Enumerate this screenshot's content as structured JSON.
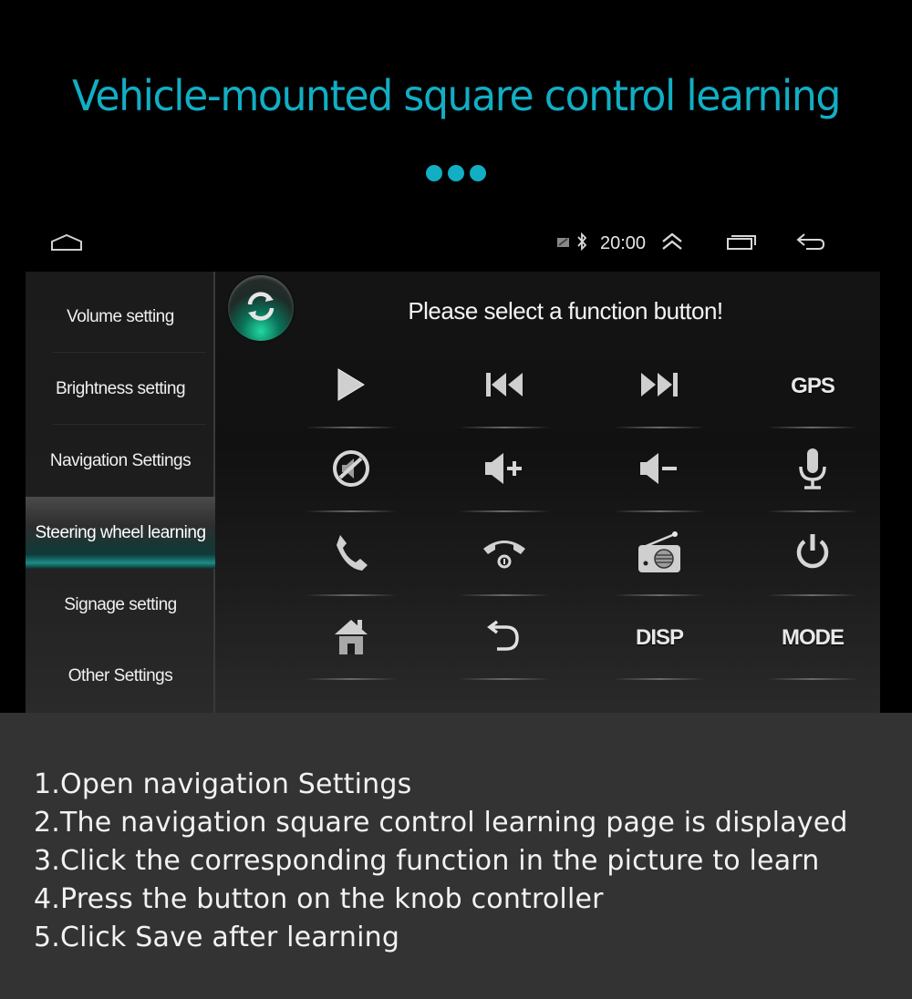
{
  "hero": {
    "title": "Vehicle-mounted square control learning",
    "accent_color": "#11aec4"
  },
  "statusbar": {
    "time": "20:00",
    "icons": [
      "home-outline-icon",
      "notification-icon",
      "bluetooth-icon",
      "expand-up-icon",
      "recent-apps-icon",
      "back-icon"
    ]
  },
  "sidebar": {
    "items": [
      {
        "label": "Volume setting",
        "active": false
      },
      {
        "label": "Brightness setting",
        "active": false
      },
      {
        "label": "Navigation Settings",
        "active": false
      },
      {
        "label": "Steering wheel learning",
        "active": true
      },
      {
        "label": "Signage setting",
        "active": false
      },
      {
        "label": "Other Settings",
        "active": false
      }
    ]
  },
  "panel": {
    "prompt": "Please select a function button!",
    "refresh_icon": "refresh-icon",
    "buttons": [
      {
        "name": "play",
        "icon": "play-icon",
        "label": ""
      },
      {
        "name": "previous",
        "icon": "previous-track-icon",
        "label": ""
      },
      {
        "name": "next",
        "icon": "next-track-icon",
        "label": ""
      },
      {
        "name": "gps",
        "icon": "",
        "label": "GPS"
      },
      {
        "name": "mute",
        "icon": "mute-icon",
        "label": ""
      },
      {
        "name": "volume-up",
        "icon": "volume-up-icon",
        "label": ""
      },
      {
        "name": "volume-down",
        "icon": "volume-down-icon",
        "label": ""
      },
      {
        "name": "voice",
        "icon": "microphone-icon",
        "label": ""
      },
      {
        "name": "call",
        "icon": "phone-answer-icon",
        "label": ""
      },
      {
        "name": "hang-up",
        "icon": "phone-hangup-icon",
        "label": ""
      },
      {
        "name": "radio",
        "icon": "radio-icon",
        "label": ""
      },
      {
        "name": "power",
        "icon": "power-icon",
        "label": ""
      },
      {
        "name": "home",
        "icon": "home-icon",
        "label": ""
      },
      {
        "name": "back",
        "icon": "return-icon",
        "label": ""
      },
      {
        "name": "disp",
        "icon": "",
        "label": "DISP"
      },
      {
        "name": "mode",
        "icon": "",
        "label": "MODE"
      }
    ]
  },
  "instructions": [
    "1.Open navigation Settings",
    "2.The navigation square control learning page is displayed",
    "3.Click the corresponding function in the picture to learn",
    "4.Press the button on the knob controller",
    "5.Click Save after learning"
  ]
}
